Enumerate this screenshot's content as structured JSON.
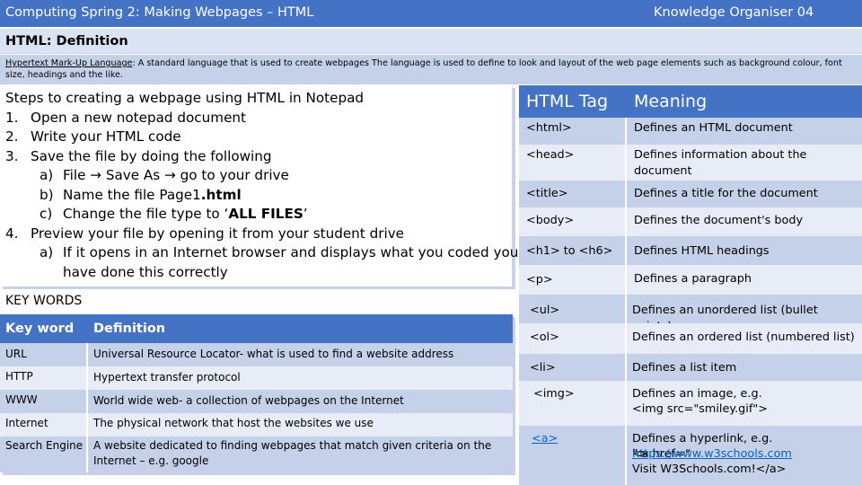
{
  "header": {
    "title": "Computing Spring 2:  Making Webpages – HTML",
    "organiser": "Knowledge Organiser 04"
  },
  "definition": {
    "heading": "HTML: Definition",
    "term": "Hypertext Mark-Up Language",
    "text": ": A standard language that is used to create webpages  The language is used to define to look and layout of the web page elements such as background colour, font size, headings and the like."
  },
  "steps": {
    "title": "Steps to creating a webpage using HTML in Notepad",
    "s1_num": "1.",
    "s1": "Open a new notepad document",
    "s2_num": "2.",
    "s2": "Write your HTML code",
    "s3_num": "3.",
    "s3": "Save the file by doing the following",
    "s3a_num": "a)",
    "s3a_1": "File",
    "s3a_2": "Save As",
    "s3a_3": "go to your drive",
    "s3b_num": "b)",
    "s3b_pre": "Name the file Page1",
    "s3b_bold": ".html",
    "s3c_num": "c)",
    "s3c_pre": "Change the file type to ‘",
    "s3c_bold": "ALL FILES",
    "s3c_post": "’",
    "s4_num": "4.",
    "s4": "Preview your file by opening it from your student drive",
    "s4a_num": "a)",
    "s4a_line1": "If it opens in an Internet browser and displays what you coded you",
    "s4a_line2": "have done this correctly"
  },
  "keywords": {
    "title": "KEY WORDS",
    "col_word": "Key word",
    "col_def": "Definition",
    "rows": [
      {
        "word": "URL",
        "def": "Universal Resource Locator- what is used to find a website address"
      },
      {
        "word": "HTTP",
        "def": "Hypertext transfer protocol"
      },
      {
        "word": "WWW",
        "def": "World wide web- a collection of webpages on the Internet"
      },
      {
        "word": "Internet",
        "def": "The physical network that host the websites we use"
      },
      {
        "word": "Search Engine",
        "def": "A website dedicated to finding webpages that match given criteria on the Internet – e.g. google"
      }
    ]
  },
  "tags": {
    "col_tag": "HTML Tag",
    "col_meaning": "Meaning",
    "rows": [
      {
        "tag": "<html>",
        "meaning": "Defines an HTML document"
      },
      {
        "tag": "<head>",
        "meaning": "Defines information about the document"
      },
      {
        "tag": "<title>",
        "meaning": "Defines a title for the document"
      },
      {
        "tag": "<body>",
        "meaning": "Defines the document's body"
      },
      {
        "tag": "<h1> to <h6>",
        "meaning": "Defines HTML headings"
      },
      {
        "tag": "<p>",
        "meaning": "Defines a paragraph"
      },
      {
        "tag": "<ul>",
        "meaning": "Defines an unordered list (bullet points)"
      },
      {
        "tag": "<ol>",
        "meaning": "Defines an ordered list (numbered list)"
      },
      {
        "tag": "<li>",
        "meaning": "Defines a list item"
      },
      {
        "tag": "<img>",
        "meaning_line1": "Defines an image, e.g.",
        "meaning_line2": "<img src=\"smiley.gif\">"
      },
      {
        "tag": "<a>",
        "meaning_line1": "Defines a hyperlink, e.g.",
        "m2_pre": "<a href=“",
        "m2_link": "https://www.w3schools.com",
        "m2_post": "”>",
        "meaning_line3": "Visit W3Schools.com!</a>"
      }
    ]
  },
  "colors": {
    "accent": "#4472c4",
    "row_dark": "#c5d1e9",
    "row_light": "#e7ecf6"
  }
}
